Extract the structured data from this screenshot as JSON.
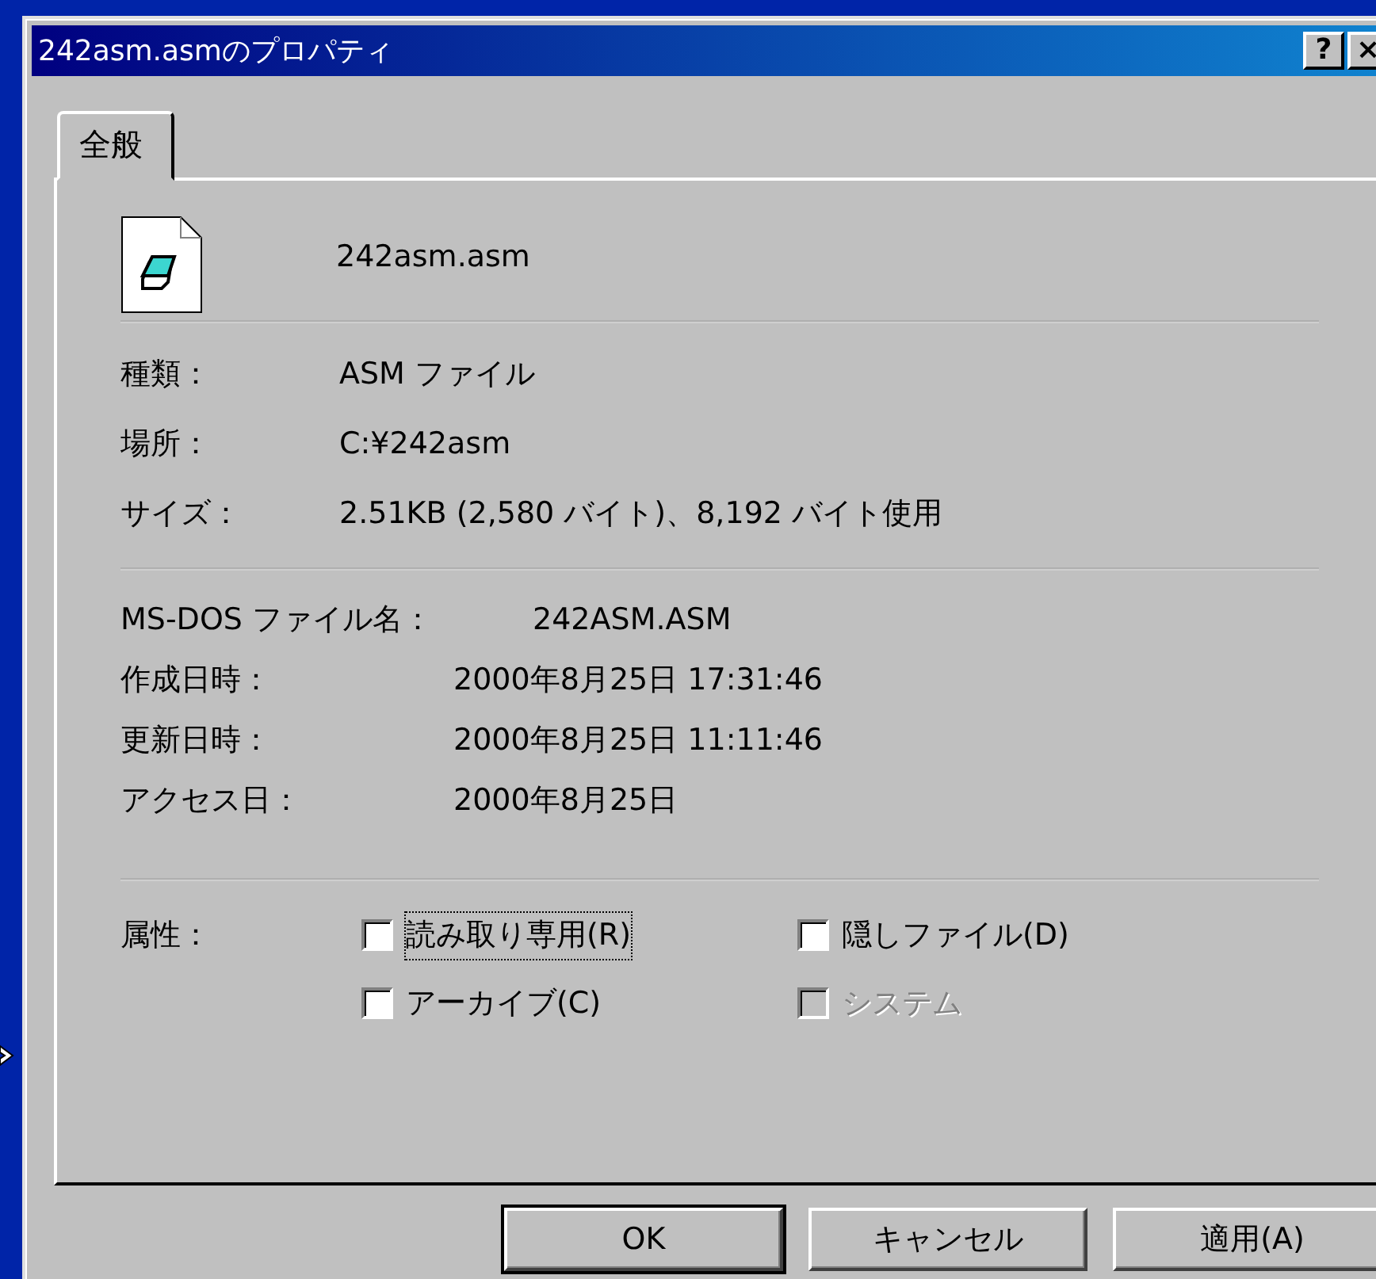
{
  "window": {
    "title": "242asm.asmのプロパティ",
    "title_buttons": [
      "?",
      "×"
    ]
  },
  "tabs": [
    {
      "label": "全般",
      "selected": true
    }
  ],
  "file": {
    "name": "242asm.asm"
  },
  "info": [
    {
      "label": "種類：",
      "value": "ASM ファイル"
    },
    {
      "label": "場所：",
      "value": "C:¥242asm"
    },
    {
      "label": "サイズ：",
      "value": "2.51KB (2,580 バイト)、8,192 バイト使用"
    }
  ],
  "dates": [
    {
      "label": "MS-DOS ファイル名：",
      "value": "242ASM.ASM",
      "kind": "wide"
    },
    {
      "label": "作成日時：",
      "value": "2000年8月25日 17:31:46",
      "kind": "normal"
    },
    {
      "label": "更新日時：",
      "value": "2000年8月25日 11:11:46",
      "kind": "normal"
    },
    {
      "label": "アクセス日：",
      "value": "2000年8月25日",
      "kind": "normal"
    }
  ],
  "attributes": {
    "label": "属性：",
    "items": [
      {
        "label": "読み取り専用(R)",
        "checked": false,
        "disabled": false,
        "focused": true
      },
      {
        "label": "隠しファイル(D)",
        "checked": false,
        "disabled": false,
        "focused": false
      },
      {
        "label": "アーカイブ(C)",
        "checked": false,
        "disabled": false,
        "focused": false
      },
      {
        "label": "システム",
        "checked": false,
        "disabled": true,
        "focused": false
      }
    ]
  },
  "buttons": [
    {
      "label": "OK",
      "default": true
    },
    {
      "label": "キャンセル",
      "default": false
    },
    {
      "label": "適用(A)",
      "default": false
    }
  ]
}
